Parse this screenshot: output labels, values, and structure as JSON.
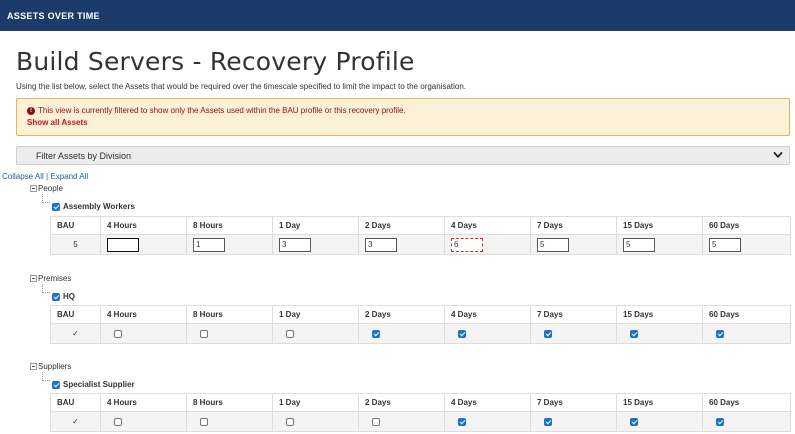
{
  "header": {
    "title": "ASSETS OVER TIME"
  },
  "page": {
    "title": "Build Servers - Recovery Profile",
    "subtitle": "Using the list below, select the Assets that would be required over the timescale specified to limit the impact to the organisation."
  },
  "alert": {
    "message": "This view is currently filtered to show only the Assets used within the BAU profile or this recovery profile.",
    "link": "Show all Assets"
  },
  "filter": {
    "label": "Filter Assets by Division"
  },
  "tree": {
    "collapse_all": "Collapse All",
    "separator": "|",
    "expand_all": "Expand All"
  },
  "columns": [
    "BAU",
    "4 Hours",
    "8 Hours",
    "1 Day",
    "2 Days",
    "4 Days",
    "7 Days",
    "15 Days",
    "60 Days"
  ],
  "groups": [
    {
      "name": "People",
      "asset": "Assembly Workers",
      "bau": "5",
      "values": [
        "",
        "1",
        "3",
        "3",
        "6",
        "5",
        "5",
        "5"
      ]
    },
    {
      "name": "Premises",
      "asset": "HQ",
      "bau": "✓",
      "checks": [
        false,
        false,
        false,
        true,
        true,
        true,
        true,
        true
      ]
    },
    {
      "name": "Suppliers",
      "asset": "Specialist Supplier",
      "bau": "✓",
      "checks": [
        false,
        false,
        false,
        false,
        true,
        true,
        true,
        true
      ]
    }
  ],
  "colors": {
    "header": "#1b3c6b",
    "alert_bg": "#fcf1d7",
    "alert_text": "#8a1111",
    "checkbox": "#1d72c9",
    "invalid_border": "#d9252a"
  }
}
